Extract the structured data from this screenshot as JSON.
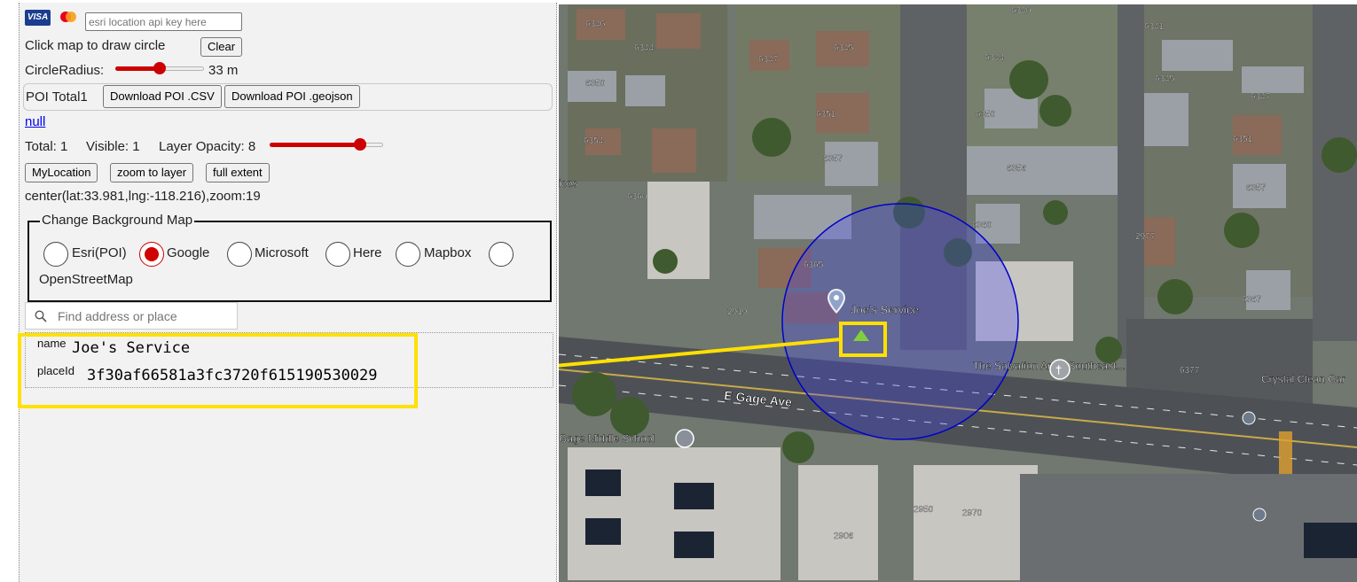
{
  "payment": {
    "visa_label": "VISA",
    "mastercard_icon": "mastercard-icon"
  },
  "apikey": {
    "placeholder": "esri location api key here"
  },
  "draw": {
    "instruction": "Click map to draw circle",
    "clear_label": "Clear"
  },
  "radius": {
    "label": "CircleRadius:",
    "value_text": "33 m",
    "level": 0.5
  },
  "poi": {
    "total_label": "POI Total1",
    "csv_button": "Download POI .CSV",
    "geojson_button": "Download POI .geojson",
    "link_text": "null"
  },
  "stats": {
    "total": "Total: 1",
    "visible": "Visible: 1",
    "opacity_label": "Layer Opacity: 8",
    "opacity_level": 0.8
  },
  "actions": {
    "my_location": "MyLocation",
    "zoom_to_layer": "zoom to layer",
    "full_extent": "full extent"
  },
  "center_text": "center(lat:33.981,lng:-118.216),zoom:19",
  "background": {
    "legend": "Change Background Map",
    "options": [
      "Esri(POI)",
      "Google",
      "Microsoft",
      "Here",
      "Mapbox",
      "OpenStreetMap"
    ],
    "selected": "Google"
  },
  "search": {
    "placeholder": "Find address or place",
    "icon": "search-icon"
  },
  "info": {
    "name_label": "name",
    "name_value": "Joe's Service",
    "placeid_label": "placeId",
    "placeid_value": "3f30af66581a3fc3720f615190530029"
  },
  "map": {
    "poi_label": "Joe's Service",
    "street": "E Gage Ave",
    "places": [
      "The Salvation Army Southeast...",
      "Gage Middle School",
      "Crystal Clean Car",
      "icos"
    ],
    "house_numbers": [
      "6346",
      "6344",
      "6340",
      "6341",
      "6345",
      "6347",
      "6344",
      "6350",
      "6345",
      "6347",
      "6351",
      "6350",
      "6351",
      "6354",
      "6357",
      "6356",
      "6357",
      "6360",
      "6360",
      "2977",
      "6365",
      "2919",
      "6367",
      "6377",
      "2950",
      "2970",
      "2906"
    ],
    "colors": {
      "circle_stroke": "#0000cc",
      "circle_fill": "#4040ff",
      "highlight": "#ffe000",
      "radio_selected": "#d00000",
      "slider": "#cc0000"
    }
  }
}
